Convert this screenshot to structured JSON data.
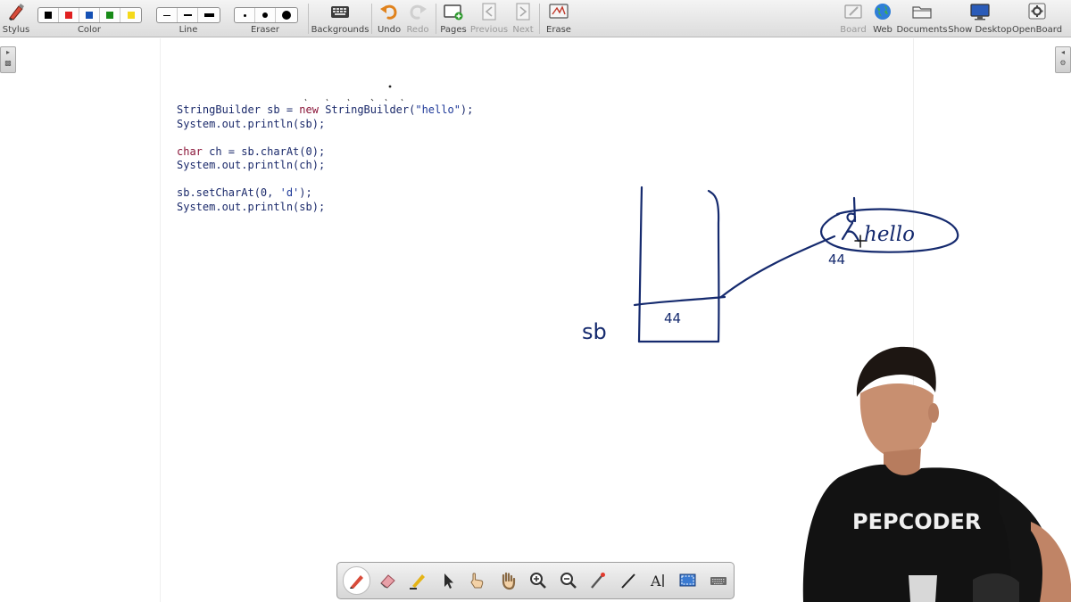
{
  "toolbar": {
    "stylus": "Stylus",
    "color": "Color",
    "line": "Line",
    "eraser": "Eraser",
    "backgrounds": "Backgrounds",
    "undo": "Undo",
    "redo": "Redo",
    "pages": "Pages",
    "previous": "Previous",
    "next": "Next",
    "erase": "Erase",
    "board": "Board",
    "web": "Web",
    "documents": "Documents",
    "show_desktop": "Show Desktop",
    "openboard": "OpenBoard"
  },
  "colors": [
    "#000000",
    "#e02020",
    "#1450b4",
    "#178a17",
    "#f5d91a"
  ],
  "code_lines": [
    [
      "StringBuilder sb = ",
      "new",
      " StringBuilder(",
      "\"hello\"",
      ");"
    ],
    [
      "System.out.println(sb);"
    ],
    [
      ""
    ],
    [
      "char",
      " ch = sb.charAt(0);"
    ],
    [
      "System.out.println(ch);"
    ],
    [
      ""
    ],
    [
      "sb.setCharAt(0, ",
      "'d'",
      ");"
    ],
    [
      "System.out.println(sb);"
    ]
  ],
  "sketch": {
    "var_label": "sb",
    "address_in_box": "44",
    "address_near_obj": "44",
    "object_text": "hello",
    "replaced_char": "d"
  },
  "shirt_text": "PEPCODER",
  "floating_tools": [
    "pen-tool",
    "eraser-tool",
    "marker-tool",
    "selector-tool",
    "interact-tool",
    "hand-tool",
    "zoom-in-tool",
    "zoom-out-tool",
    "laser-tool",
    "line-tool",
    "text-tool",
    "capture-tool",
    "keyboard-tool"
  ]
}
